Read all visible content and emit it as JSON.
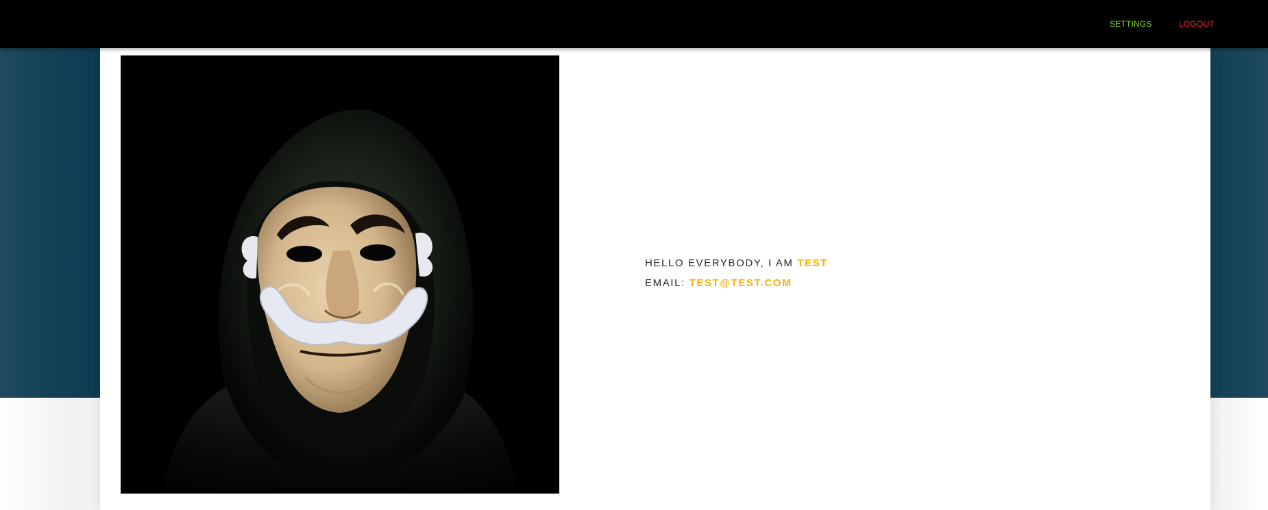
{
  "nav": {
    "settings_label": "SETTINGS",
    "logout_label": "LOGOUT"
  },
  "profile": {
    "greeting_prefix": "HELLO EVERYBODY, I AM",
    "name": "TEST",
    "email_label": "EMAIL:",
    "email": "TEST@TEST.COM"
  },
  "colors": {
    "navbar": "#000000",
    "hero": "#0f3c52",
    "accent": "#f5b10a",
    "settings": "#7ed321",
    "logout": "#ff1f1f"
  }
}
